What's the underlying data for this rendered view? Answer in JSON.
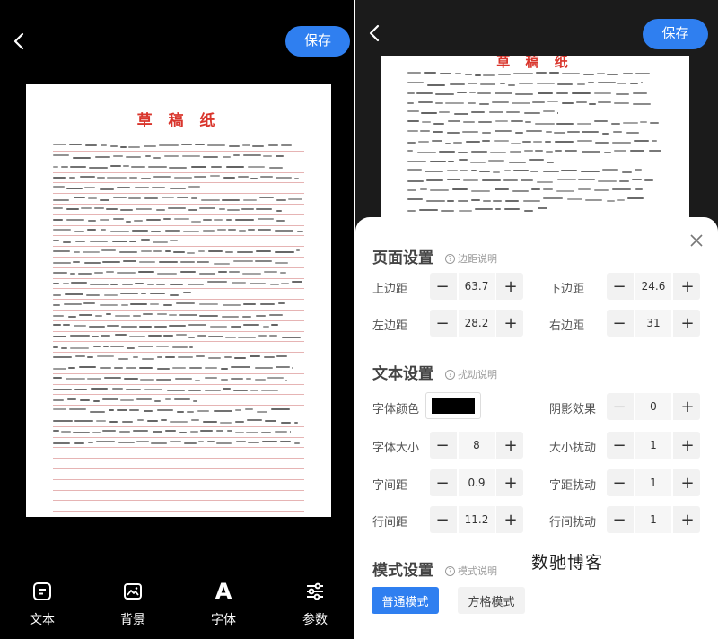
{
  "editor": {
    "save_label": "保存",
    "paper_title": "草 稿 纸",
    "toolbar": [
      {
        "label": "文本",
        "icon": "text-icon"
      },
      {
        "label": "背景",
        "icon": "image-icon"
      },
      {
        "label": "字体",
        "icon": "font-icon",
        "glyph": "A"
      },
      {
        "label": "参数",
        "icon": "sliders-icon"
      }
    ]
  },
  "settings": {
    "page": {
      "title": "页面设置",
      "help": "边距说明",
      "top_margin": {
        "label": "上边距",
        "value": "63.7"
      },
      "bottom_margin": {
        "label": "下边距",
        "value": "24.6"
      },
      "left_margin": {
        "label": "左边距",
        "value": "28.2"
      },
      "right_margin": {
        "label": "右边距",
        "value": "31"
      }
    },
    "text": {
      "title": "文本设置",
      "help": "扰动说明",
      "font_color": {
        "label": "字体颜色",
        "color": "#000000"
      },
      "shadow": {
        "label": "阴影效果",
        "value": "0"
      },
      "font_size": {
        "label": "字体大小",
        "value": "8"
      },
      "size_jitter": {
        "label": "大小扰动",
        "value": "1"
      },
      "char_spacing": {
        "label": "字间距",
        "value": "0.9"
      },
      "spacing_jitter": {
        "label": "字距扰动",
        "value": "1"
      },
      "line_spacing": {
        "label": "行间距",
        "value": "11.2"
      },
      "line_jitter": {
        "label": "行间扰动",
        "value": "1"
      }
    },
    "mode": {
      "title": "模式设置",
      "help": "模式说明",
      "options": [
        "普通模式",
        "方格模式"
      ],
      "selected": "普通模式"
    }
  },
  "watermark": "数驰博客",
  "colors": {
    "accent": "#2f7ff0",
    "title_red": "#d9352c"
  }
}
